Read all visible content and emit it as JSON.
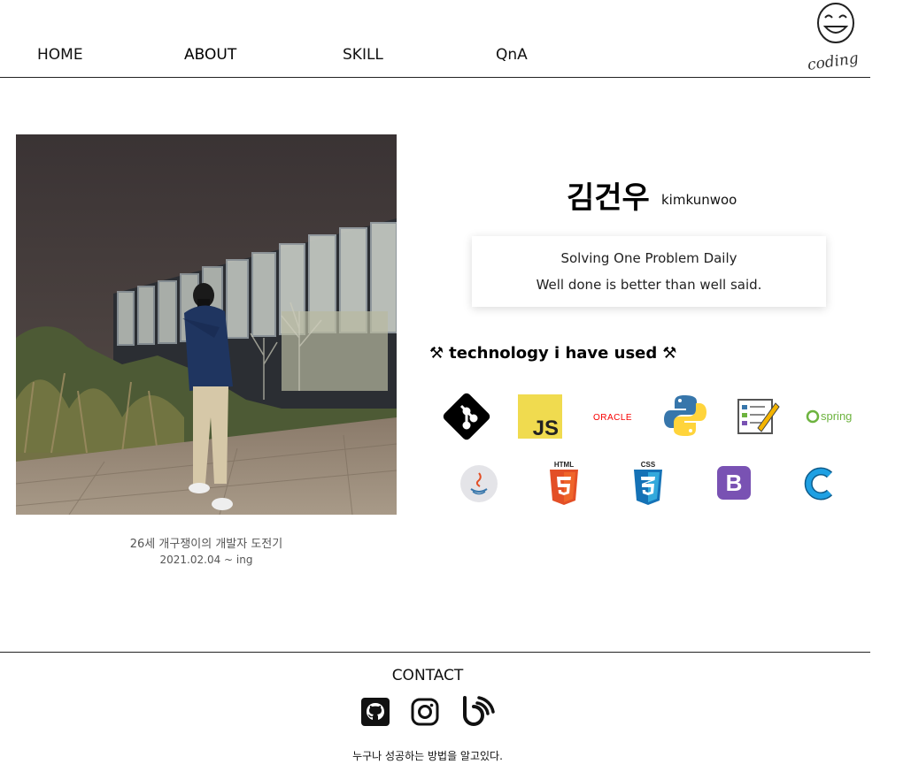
{
  "nav": {
    "items": [
      {
        "label": "HOME"
      },
      {
        "label": "ABOUT"
      },
      {
        "label": "SKILL"
      },
      {
        "label": "QnA"
      }
    ],
    "logo_text": "coding"
  },
  "profile": {
    "caption_line1": "26세 개구쟁이의 개발자 도전기",
    "caption_line2": "2021.02.04 ~ ing",
    "name": "김건우",
    "handle": "kimkunwoo",
    "motto_line1": "Solving One Problem Daily",
    "motto_line2": "Well done is better than well said."
  },
  "technologies": {
    "title": "technology i have used",
    "icons": [
      "git-icon",
      "javascript-icon",
      "oracle-icon",
      "python-icon",
      "editor-icon",
      "spring-icon",
      "java-icon",
      "html5-icon",
      "css3-icon",
      "bootstrap-icon",
      "c-language-icon"
    ],
    "oracle_label": "ORACLE",
    "spring_label": "spring",
    "js_label": "JS",
    "html_label": "HTML",
    "css_label": "CSS",
    "bootstrap_label": "B",
    "c_label": "C"
  },
  "footer": {
    "contact_label": "CONTACT",
    "social_icons": [
      "github-icon",
      "instagram-icon",
      "blog-icon"
    ],
    "tagline": "누구나 성공하는 방법을 알고있다."
  },
  "colors": {
    "js_yellow": "#f0db4f",
    "oracle_red": "#f80000",
    "python_blue": "#3776ab",
    "python_yellow": "#ffd43b",
    "spring_green": "#6db33f",
    "html_orange": "#e34f26",
    "css_blue": "#1572b6",
    "bootstrap_purple": "#7952b3",
    "c_blue": "#1ea0e3"
  }
}
